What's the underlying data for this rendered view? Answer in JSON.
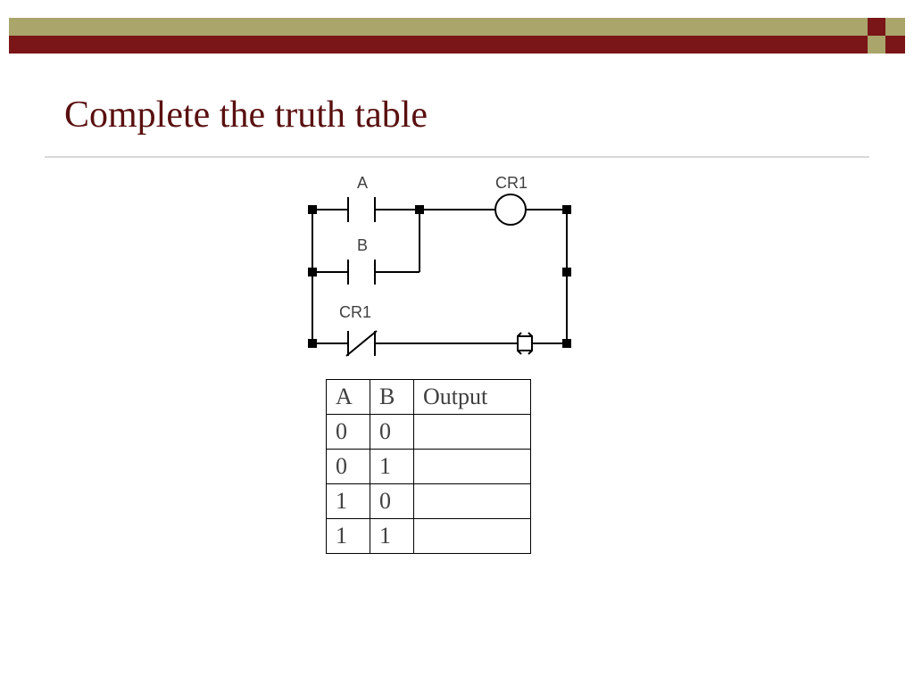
{
  "title": "Complete the truth table",
  "ladder": {
    "labels": {
      "a": "A",
      "b": "B",
      "cr1_top": "CR1",
      "cr1_bottom": "CR1"
    }
  },
  "truth_table": {
    "headers": [
      "A",
      "B",
      "Output"
    ],
    "rows": [
      {
        "a": "0",
        "b": "0",
        "out": ""
      },
      {
        "a": "0",
        "b": "1",
        "out": ""
      },
      {
        "a": "1",
        "b": "0",
        "out": ""
      },
      {
        "a": "1",
        "b": "1",
        "out": ""
      }
    ]
  },
  "colors": {
    "olive": "#a9a56b",
    "maroon": "#7a1518",
    "title": "#5a1010"
  }
}
